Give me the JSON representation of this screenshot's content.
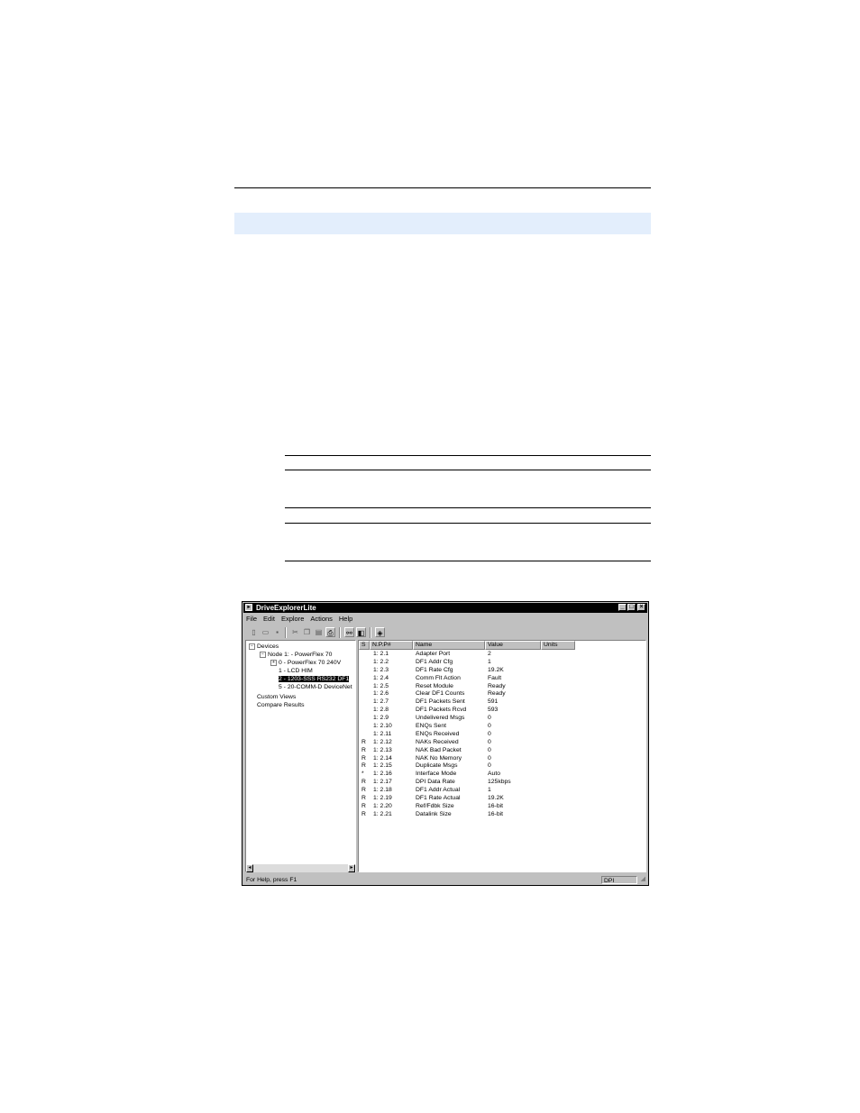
{
  "window": {
    "title": "DriveExplorerLite",
    "app_icon": "app-icon",
    "min_icon": "_",
    "max_icon": "□",
    "close_icon": "×"
  },
  "menu": [
    {
      "label": "File"
    },
    {
      "label": "Edit"
    },
    {
      "label": "Explore"
    },
    {
      "label": "Actions"
    },
    {
      "label": "Help"
    }
  ],
  "toolbar": [
    {
      "icon": "new-icon",
      "glyph": "▯"
    },
    {
      "icon": "open-icon",
      "glyph": "▭"
    },
    {
      "icon": "save-icon",
      "glyph": "▪"
    },
    {
      "icon": "cut-icon",
      "glyph": "✂"
    },
    {
      "icon": "copy-icon",
      "glyph": "❐"
    },
    {
      "icon": "paste-icon",
      "glyph": "▤"
    },
    {
      "icon": "print-icon",
      "glyph": "⎙"
    },
    {
      "icon": "connect-icon",
      "glyph": "⚯"
    },
    {
      "icon": "properties-icon",
      "glyph": "◧"
    },
    {
      "icon": "help-icon",
      "glyph": "◈"
    }
  ],
  "tree": [
    {
      "label": "Devices",
      "expander": "−"
    },
    {
      "label": "Node 1: - PowerFlex 70",
      "expander": "−"
    },
    {
      "label": "0 - PowerFlex 70    240V",
      "expander": "+"
    },
    {
      "label": "1 - LCD HIM",
      "expander": ""
    },
    {
      "label": "2 - 1203-SSS RS232 DF1",
      "expander": ""
    },
    {
      "label": "5 - 20-COMM-D DeviceNet",
      "expander": ""
    },
    {
      "label": "Custom Views",
      "expander": ""
    },
    {
      "label": "Compare Results",
      "expander": ""
    }
  ],
  "columns": [
    "S",
    "N.P.P#",
    "Name",
    "Value",
    "Units"
  ],
  "rows": [
    {
      "s": "",
      "npp": "1: 2.1",
      "name": "Adapter Port",
      "value": "2"
    },
    {
      "s": "",
      "npp": "1: 2.2",
      "name": "DF1 Addr Cfg",
      "value": "1"
    },
    {
      "s": "",
      "npp": "1: 2.3",
      "name": "DF1 Rate Cfg",
      "value": "19.2K"
    },
    {
      "s": "",
      "npp": "1: 2.4",
      "name": "Comm Flt Action",
      "value": "Fault"
    },
    {
      "s": "",
      "npp": "1: 2.5",
      "name": "Reset Module",
      "value": "Ready"
    },
    {
      "s": "",
      "npp": "1: 2.6",
      "name": "Clear DF1 Counts",
      "value": "Ready"
    },
    {
      "s": "",
      "npp": "1: 2.7",
      "name": "DF1 Packets Sent",
      "value": "591"
    },
    {
      "s": "",
      "npp": "1: 2.8",
      "name": "DF1 Packets Rcvd",
      "value": "593"
    },
    {
      "s": "",
      "npp": "1: 2.9",
      "name": "Undelivered Msgs",
      "value": "0"
    },
    {
      "s": "",
      "npp": "1: 2.10",
      "name": "ENQs Sent",
      "value": "0"
    },
    {
      "s": "",
      "npp": "1: 2.11",
      "name": "ENQs Received",
      "value": "0"
    },
    {
      "s": "R",
      "npp": "1: 2.12",
      "name": "NAKs Received",
      "value": "0"
    },
    {
      "s": "R",
      "npp": "1: 2.13",
      "name": "NAK Bad Packet",
      "value": "0"
    },
    {
      "s": "R",
      "npp": "1: 2.14",
      "name": "NAK No Memory",
      "value": "0"
    },
    {
      "s": "R",
      "npp": "1: 2.15",
      "name": "Duplicate Msgs",
      "value": "0"
    },
    {
      "s": "*",
      "npp": "1: 2.16",
      "name": "Interface Mode",
      "value": "Auto"
    },
    {
      "s": "R",
      "npp": "1: 2.17",
      "name": "DPI Data Rate",
      "value": "125kbps"
    },
    {
      "s": "R",
      "npp": "1: 2.18",
      "name": "DF1 Addr Actual",
      "value": "1"
    },
    {
      "s": "R",
      "npp": "1: 2.19",
      "name": "DF1 Rate Actual",
      "value": "19.2K"
    },
    {
      "s": "R",
      "npp": "1: 2.20",
      "name": "Ref/Fdbk Size",
      "value": "16-bit"
    },
    {
      "s": "R",
      "npp": "1: 2.21",
      "name": "Datalink Size",
      "value": "16-bit"
    }
  ],
  "status": {
    "left": "For Help, press F1",
    "right": "DPI"
  },
  "colors": {
    "band": "#e3eefc",
    "window_face": "#c0c0c0",
    "titlebar": "#000000"
  }
}
